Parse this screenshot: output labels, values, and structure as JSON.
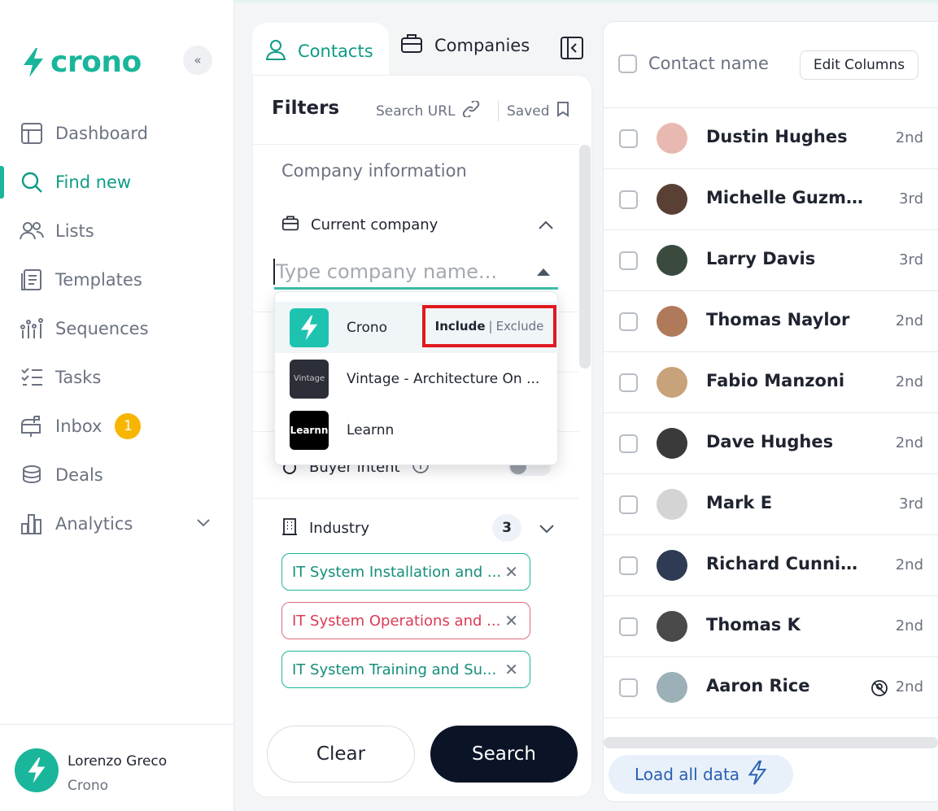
{
  "brand": {
    "name": "crono",
    "color": "#1ab69b"
  },
  "sidebar": {
    "collapse_icon": "double-chevron-left-icon",
    "items": [
      {
        "label": "Dashboard",
        "icon": "dashboard-icon"
      },
      {
        "label": "Find new",
        "icon": "search-icon",
        "active": true
      },
      {
        "label": "Lists",
        "icon": "users-icon"
      },
      {
        "label": "Templates",
        "icon": "templates-icon"
      },
      {
        "label": "Sequences",
        "icon": "sequences-icon"
      },
      {
        "label": "Tasks",
        "icon": "tasks-icon"
      },
      {
        "label": "Inbox",
        "icon": "mailbox-icon",
        "badge": "1"
      },
      {
        "label": "Deals",
        "icon": "coins-icon"
      },
      {
        "label": "Analytics",
        "icon": "analytics-icon",
        "expandable": true
      }
    ],
    "user": {
      "name": "Lorenzo Greco",
      "org": "Crono"
    }
  },
  "tabs": {
    "contacts": "Contacts",
    "companies": "Companies",
    "active": "contacts"
  },
  "filters": {
    "title": "Filters",
    "search_url": "Search URL",
    "saved": "Saved",
    "section_title": "Company information",
    "current_company": {
      "label": "Current company",
      "placeholder": "Type company name...",
      "options": [
        {
          "name": "Crono",
          "logo_text": "",
          "highlighted": true
        },
        {
          "name": "Vintage - Architecture On ...",
          "logo_text": "Vintage"
        },
        {
          "name": "Learnn",
          "logo_text": "Learnn"
        }
      ],
      "include_label": "Include",
      "exclude_label": "Exclude"
    },
    "buyer_intent": "Buyer intent",
    "industry": {
      "label": "Industry",
      "count": "3",
      "chips": [
        {
          "label": "IT System Installation and ...",
          "mode": "include"
        },
        {
          "label": "IT System Operations and ...",
          "mode": "exclude"
        },
        {
          "label": "IT System Training and Su...",
          "mode": "include"
        }
      ]
    },
    "clear_label": "Clear",
    "search_label": "Search"
  },
  "results": {
    "column_header": "Contact name",
    "edit_columns": "Edit Columns",
    "rows": [
      {
        "name": "Dustin Hughes",
        "degree": "2nd",
        "avatar_color": "#e8b9b0"
      },
      {
        "name": "Michelle Guzman",
        "degree": "3rd",
        "avatar_color": "#5a4034"
      },
      {
        "name": "Larry Davis",
        "degree": "3rd",
        "avatar_color": "#3b4a3f"
      },
      {
        "name": "Thomas Naylor",
        "degree": "2nd",
        "avatar_color": "#b07a5a"
      },
      {
        "name": "Fabio Manzoni",
        "degree": "2nd",
        "avatar_color": "#c8a27a"
      },
      {
        "name": "Dave Hughes",
        "degree": "2nd",
        "avatar_color": "#3a3a3a"
      },
      {
        "name": "Mark E",
        "degree": "3rd",
        "avatar_color": "#d4d4d4"
      },
      {
        "name": "Richard Cunning...",
        "degree": "2nd",
        "avatar_color": "#2f3b55"
      },
      {
        "name": "Thomas K",
        "degree": "2nd",
        "avatar_color": "#4a4a4a"
      },
      {
        "name": "Aaron Rice",
        "degree": "2nd",
        "avatar_color": "#9cb0b8",
        "no_contact_icon": true
      }
    ],
    "load_all_label": "Load all data"
  }
}
